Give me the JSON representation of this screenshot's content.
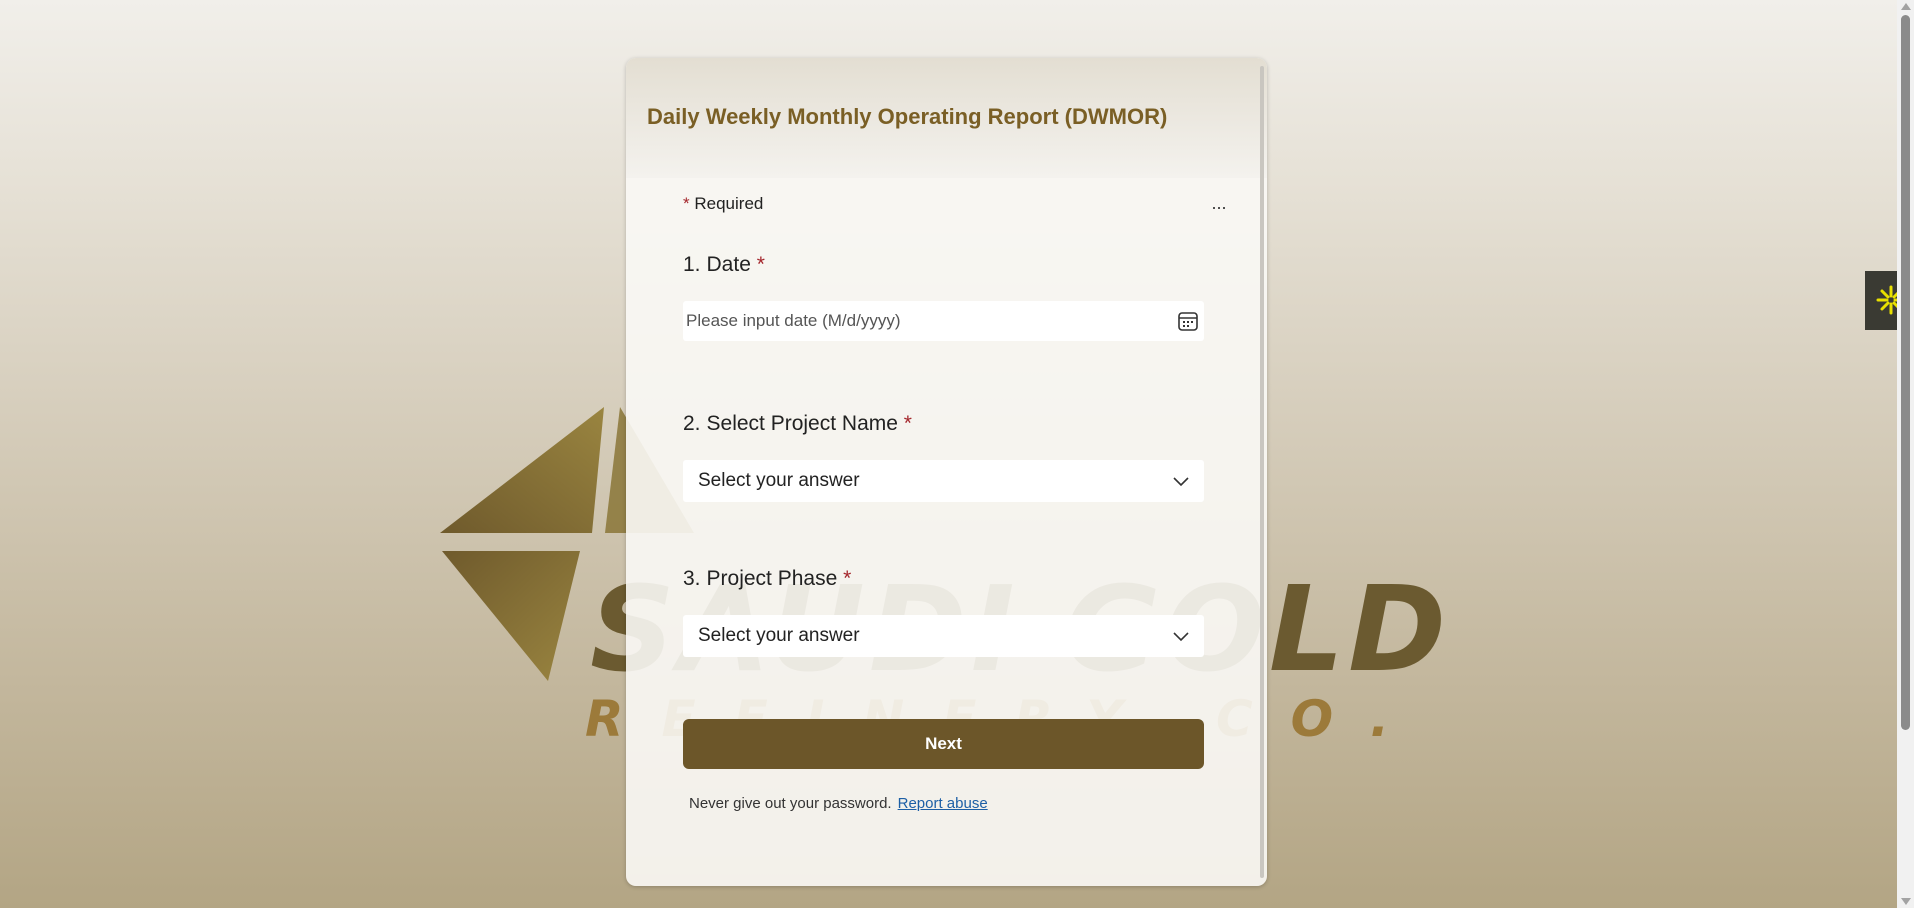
{
  "form": {
    "title": "Daily Weekly Monthly Operating Report (DWMOR)",
    "more_label": "...",
    "required_star": "*",
    "required_text": "Required",
    "questions": [
      {
        "number": "1.",
        "label": "Date",
        "star": "*",
        "placeholder": "Please input date (M/d/yyyy)"
      },
      {
        "number": "2.",
        "label": "Select Project Name",
        "star": "*",
        "selected": "Select your answer"
      },
      {
        "number": "3.",
        "label": "Project Phase",
        "star": "*",
        "selected": "Select your answer"
      }
    ],
    "next_label": "Next",
    "footer_text": "Never give out your password.",
    "report_abuse_label": "Report abuse"
  },
  "background_logo": {
    "wordmark": "SAUDI GOLD",
    "subtitle": "REFINERY CO."
  },
  "colors": {
    "title": "#7a5f25",
    "next_button": "#6c5629",
    "required_star": "#a4262c",
    "link": "#1d5fa5",
    "side_widget_bg": "#3a3a33",
    "side_widget_icon": "#e8e000"
  },
  "icons": {
    "calendar": "calendar-icon",
    "chevron": "chevron-down-icon",
    "side_widget": "asterisk-icon"
  }
}
